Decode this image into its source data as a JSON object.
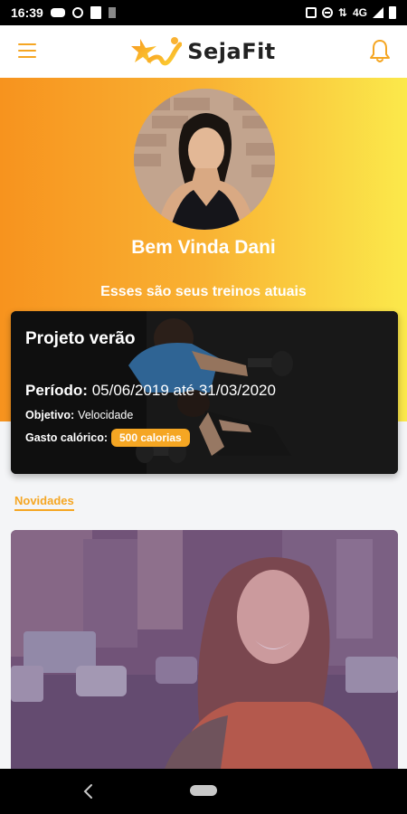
{
  "status_bar": {
    "time": "16:39",
    "network": "4G",
    "icons": [
      "gamepad-icon",
      "instagram-icon",
      "twitch-icon",
      "download-icon",
      "vibrate-icon",
      "dnd-icon",
      "data-arrows-icon",
      "signal-icon",
      "battery-icon"
    ]
  },
  "header": {
    "app_name": "SejaFit",
    "menu_icon": "hamburger-menu-icon",
    "notification_icon": "bell-icon"
  },
  "profile": {
    "greeting": "Bem Vinda Dani",
    "avatar": "user-avatar-photo"
  },
  "workouts": {
    "section_title": "Esses são seus treinos atuais",
    "current": {
      "title": "Projeto verão",
      "period_label": "Período:",
      "period_value": "05/06/2019 até 31/03/2020",
      "goal_label": "Objetivo:",
      "goal_value": "Velocidade",
      "calorie_label": "Gasto calórico:",
      "calorie_value": "500 calorias"
    }
  },
  "news": {
    "section_title": "Novidades"
  },
  "colors": {
    "accent": "#f5a623",
    "gradient_start": "#f7931e",
    "gradient_end": "#fbe94b",
    "card_bg": "#1a1a1a"
  },
  "nav_bar": {
    "back_icon": "back-chevron-icon",
    "home_icon": "home-pill-icon"
  }
}
